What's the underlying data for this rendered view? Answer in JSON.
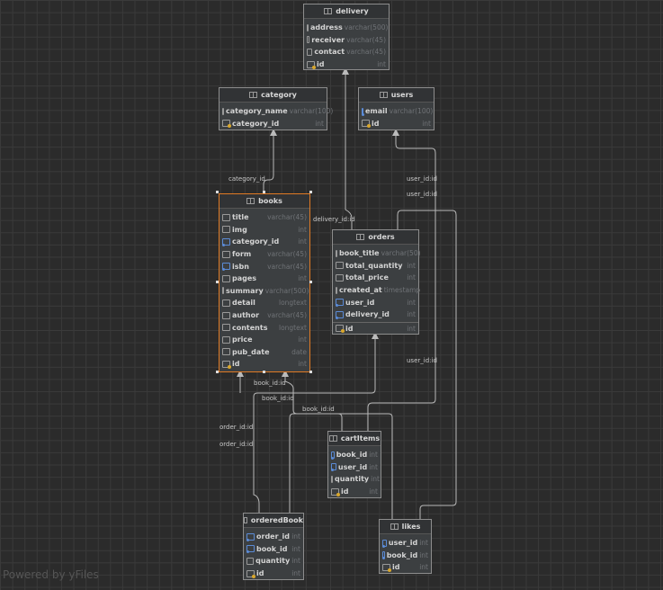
{
  "tables": {
    "delivery": {
      "name": "delivery",
      "columns": [
        {
          "name": "address",
          "type": "varchar(500)",
          "kind": "col"
        },
        {
          "name": "receiver",
          "type": "varchar(45)",
          "kind": "col"
        },
        {
          "name": "contact",
          "type": "varchar(45)",
          "kind": "col"
        },
        {
          "name": "id",
          "type": "int",
          "kind": "pk"
        }
      ]
    },
    "category": {
      "name": "category",
      "columns": [
        {
          "name": "category_name",
          "type": "varchar(100)",
          "kind": "col"
        },
        {
          "name": "category_id",
          "type": "int",
          "kind": "pk"
        }
      ]
    },
    "users": {
      "name": "users",
      "columns": [
        {
          "name": "email",
          "type": "varchar(100)",
          "kind": "fk"
        },
        {
          "name": "id",
          "type": "int",
          "kind": "pk"
        }
      ]
    },
    "books": {
      "name": "books",
      "columns": [
        {
          "name": "title",
          "type": "varchar(45)",
          "kind": "col"
        },
        {
          "name": "img",
          "type": "int",
          "kind": "col"
        },
        {
          "name": "category_id",
          "type": "int",
          "kind": "fk"
        },
        {
          "name": "form",
          "type": "varchar(45)",
          "kind": "col"
        },
        {
          "name": "isbn",
          "type": "varchar(45)",
          "kind": "fk"
        },
        {
          "name": "pages",
          "type": "int",
          "kind": "col"
        },
        {
          "name": "summary",
          "type": "varchar(500)",
          "kind": "col"
        },
        {
          "name": "detail",
          "type": "longtext",
          "kind": "col"
        },
        {
          "name": "author",
          "type": "varchar(45)",
          "kind": "col"
        },
        {
          "name": "contents",
          "type": "longtext",
          "kind": "col"
        },
        {
          "name": "price",
          "type": "int",
          "kind": "col"
        },
        {
          "name": "pub_date",
          "type": "date",
          "kind": "col"
        },
        {
          "name": "id",
          "type": "int",
          "kind": "pk"
        }
      ]
    },
    "orders": {
      "name": "orders",
      "columns": [
        {
          "name": "book_title",
          "type": "varchar(50)",
          "kind": "col"
        },
        {
          "name": "total_quantity",
          "type": "int",
          "kind": "col"
        },
        {
          "name": "total_price",
          "type": "int",
          "kind": "col"
        },
        {
          "name": "created_at",
          "type": "timestamp",
          "kind": "col"
        },
        {
          "name": "user_id",
          "type": "int",
          "kind": "fk"
        },
        {
          "name": "delivery_id",
          "type": "int",
          "kind": "fk",
          "sep_after": true
        },
        {
          "name": "id",
          "type": "int",
          "kind": "pk"
        }
      ]
    },
    "cartItems": {
      "name": "cartItems",
      "columns": [
        {
          "name": "book_id",
          "type": "int",
          "kind": "fk"
        },
        {
          "name": "user_id",
          "type": "int",
          "kind": "fk"
        },
        {
          "name": "quantity",
          "type": "int",
          "kind": "col"
        },
        {
          "name": "id",
          "type": "int",
          "kind": "pk"
        }
      ]
    },
    "orderedBook": {
      "name": "orderedBook",
      "columns": [
        {
          "name": "order_id",
          "type": "int",
          "kind": "fk"
        },
        {
          "name": "book_id",
          "type": "int",
          "kind": "fk"
        },
        {
          "name": "quantity",
          "type": "int",
          "kind": "col"
        },
        {
          "name": "id",
          "type": "int",
          "kind": "pk"
        }
      ]
    },
    "likes": {
      "name": "likes",
      "columns": [
        {
          "name": "user_id",
          "type": "int",
          "kind": "fk"
        },
        {
          "name": "book_id",
          "type": "int",
          "kind": "fk"
        },
        {
          "name": "id",
          "type": "int",
          "kind": "pk"
        }
      ]
    }
  },
  "edge_labels": [
    "category_id",
    "delivery_id:id",
    "user_id:id",
    "user_id:id",
    "user_id:id",
    "book_id:id",
    "book_id:id",
    "book_id:id",
    "order_id:id",
    "order_id:id"
  ],
  "footer": "Powered by yFiles"
}
